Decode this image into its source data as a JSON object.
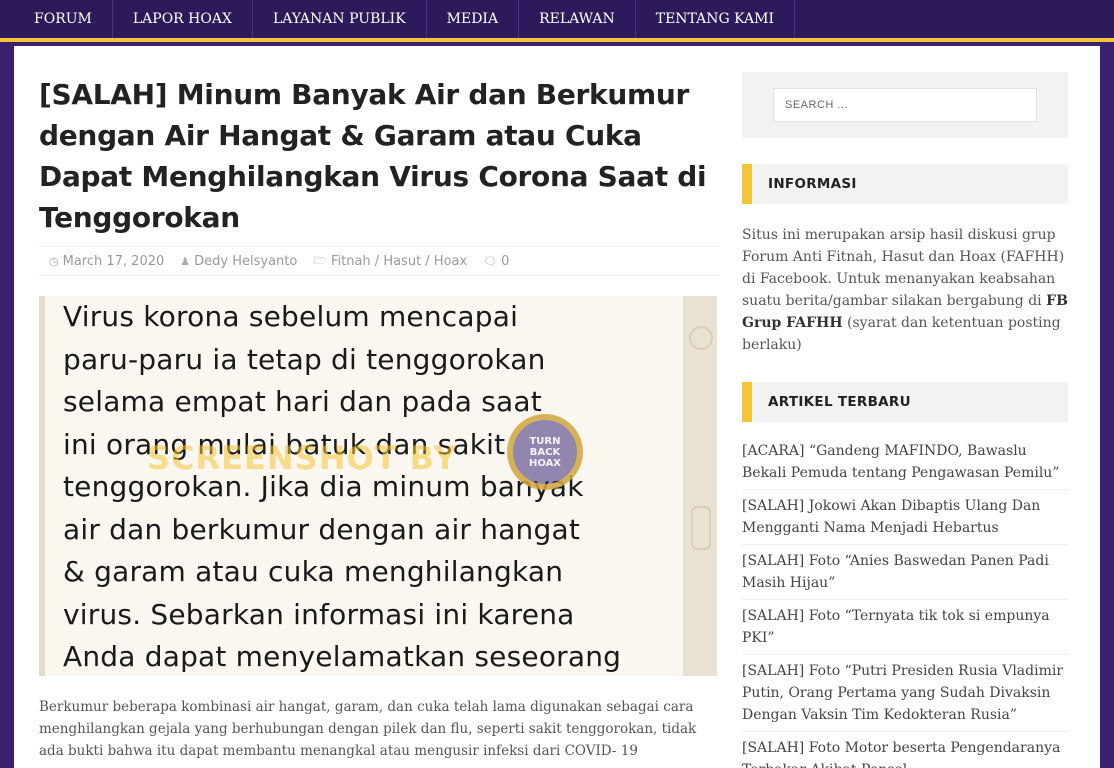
{
  "nav": {
    "items": [
      {
        "label": "FORUM"
      },
      {
        "label": "LAPOR HOAX"
      },
      {
        "label": "LAYANAN PUBLIK"
      },
      {
        "label": "MEDIA"
      },
      {
        "label": "RELAWAN"
      },
      {
        "label": "TENTANG KAMI"
      }
    ]
  },
  "article": {
    "title": "[SALAH] Minum Banyak Air dan Berkumur dengan Air Hangat & Garam atau Cuka Dapat Menghilangkan Virus Corona Saat di Tenggorokan",
    "meta": {
      "date": "March 17, 2020",
      "author": "Dedy Helsyanto",
      "category": "Fitnah / Hasut / Hoax",
      "comments": "0"
    },
    "image": {
      "lines": [
        "Virus korona sebelum mencapai",
        "paru-paru ia tetap di tenggorokan",
        "selama empat hari dan pada saat",
        "ini orang mulai batuk dan sakit",
        "tenggorokan. Jika dia minum banyak",
        "air dan berkumur dengan air hangat",
        "& garam atau cuka menghilangkan",
        "virus. Sebarkan informasi ini karena",
        "Anda dapat menyelamatkan seseorang"
      ],
      "watermark": "SCREENSHOT BY",
      "logo_top": "TURN",
      "logo_mid": "BACK",
      "logo_bottom": "HOAX"
    },
    "body": "Berkumur beberapa kombinasi air hangat, garam, dan cuka telah lama digunakan sebagai cara menghilangkan gejala yang berhubungan dengan pilek dan flu, seperti sakit tenggorokan, tidak ada bukti bahwa itu dapat membantu menangkal atau mengusir infeksi dari COVID- 19"
  },
  "sidebar": {
    "search": {
      "placeholder": "SEARCH ..."
    },
    "info": {
      "title": "INFORMASI",
      "text_before": "Situs ini merupakan arsip hasil diskusi grup Forum Anti Fitnah, Hasut dan Hoax (FAFHH) di Facebook. Untuk menanyakan keabsahan suatu berita/gambar silakan bergabung di ",
      "link": "FB Grup FAFHH",
      "text_after": " (syarat dan ketentuan posting berlaku)"
    },
    "recent": {
      "title": "ARTIKEL TERBARU",
      "items": [
        {
          "label": "[ACARA] “Gandeng MAFINDO, Bawaslu Bekali Pemuda tentang Pengawasan Pemilu”"
        },
        {
          "label": "[SALAH] Jokowi Akan Dibaptis Ulang Dan Mengganti Nama Menjadi Hebartus"
        },
        {
          "label": "[SALAH] Foto “Anies Baswedan Panen Padi Masih Hijau”"
        },
        {
          "label": "[SALAH] Foto “Ternyata tik tok si empunya PKI”"
        },
        {
          "label": "[SALAH] Foto “Putri Presiden Rusia Vladimir Putin, Orang Pertama yang Sudah Divaksin Dengan Vaksin Tim Kedokteran Rusia”"
        },
        {
          "label": "[SALAH] Foto Motor beserta Pengendaranya Terbakar Akibat Ponsel"
        }
      ]
    }
  },
  "colors": {
    "nav_bg": "#2c1a5a",
    "accent": "#f4c534",
    "page_bg": "#3a2170"
  },
  "icons": {
    "date": "clock-icon",
    "author": "user-icon",
    "category": "folder-icon",
    "comments": "comment-icon"
  }
}
